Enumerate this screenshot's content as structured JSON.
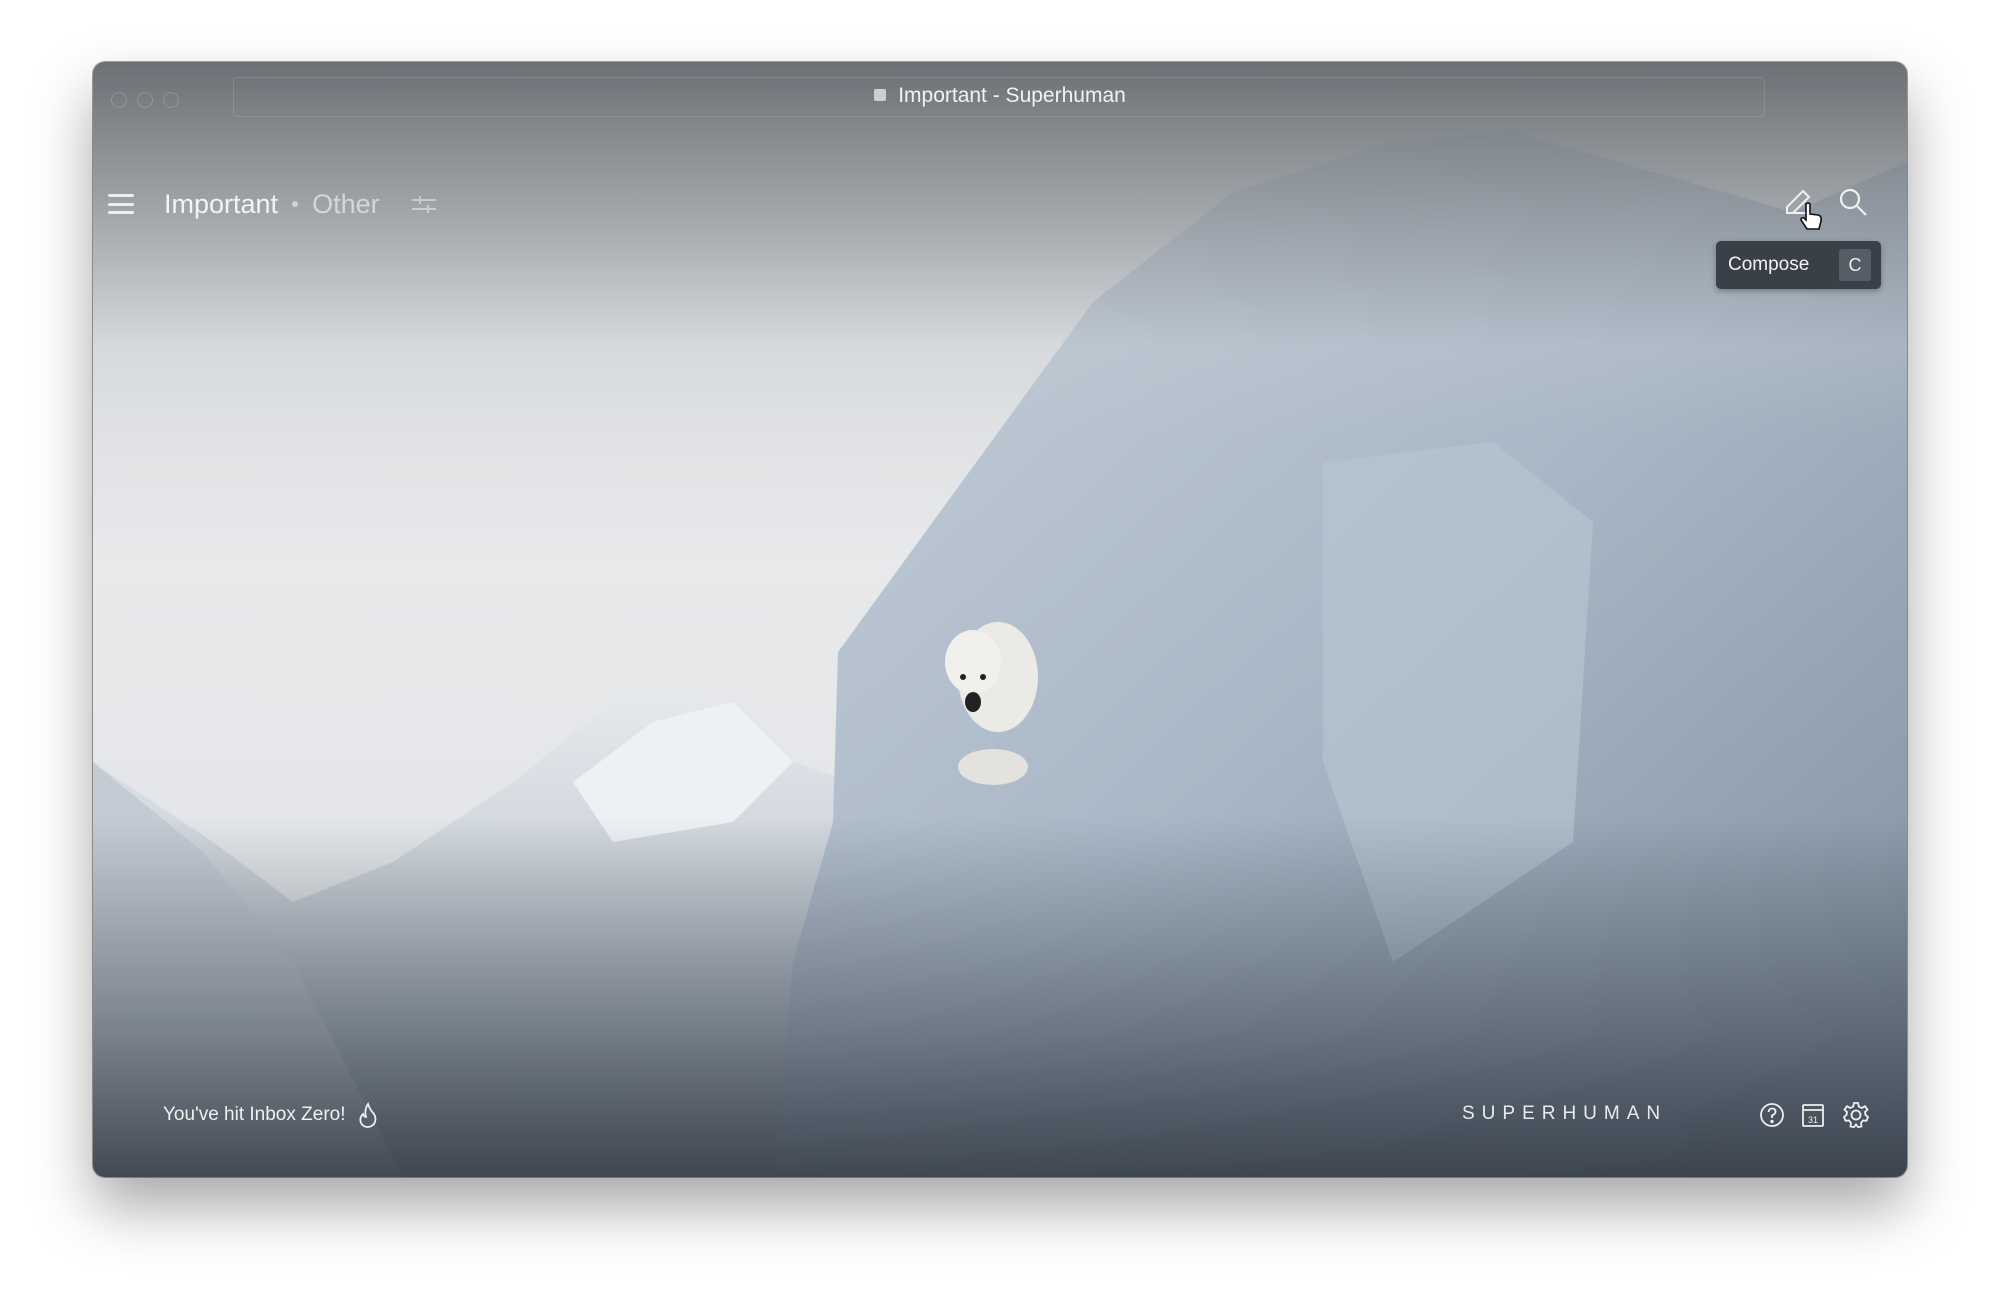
{
  "window": {
    "title": "Important - Superhuman"
  },
  "nav": {
    "tabs": [
      {
        "label": "Important",
        "active": true
      },
      {
        "label": "Other",
        "active": false
      }
    ],
    "menu_icon": "hamburger-icon",
    "filter_icon": "sliders-icon"
  },
  "toolbar": {
    "compose_icon": "pencil-icon",
    "search_icon": "search-icon"
  },
  "tooltip": {
    "label": "Compose",
    "shortcut": "C"
  },
  "footer": {
    "message": "You've hit Inbox Zero!",
    "message_icon": "flame-icon",
    "brand": "SUPERHUMAN",
    "icons": [
      "help-icon",
      "calendar-icon",
      "gear-icon"
    ],
    "calendar_day": "31"
  },
  "colors": {
    "tooltip_bg": "#3a4048",
    "text": "#f3f3f3"
  }
}
